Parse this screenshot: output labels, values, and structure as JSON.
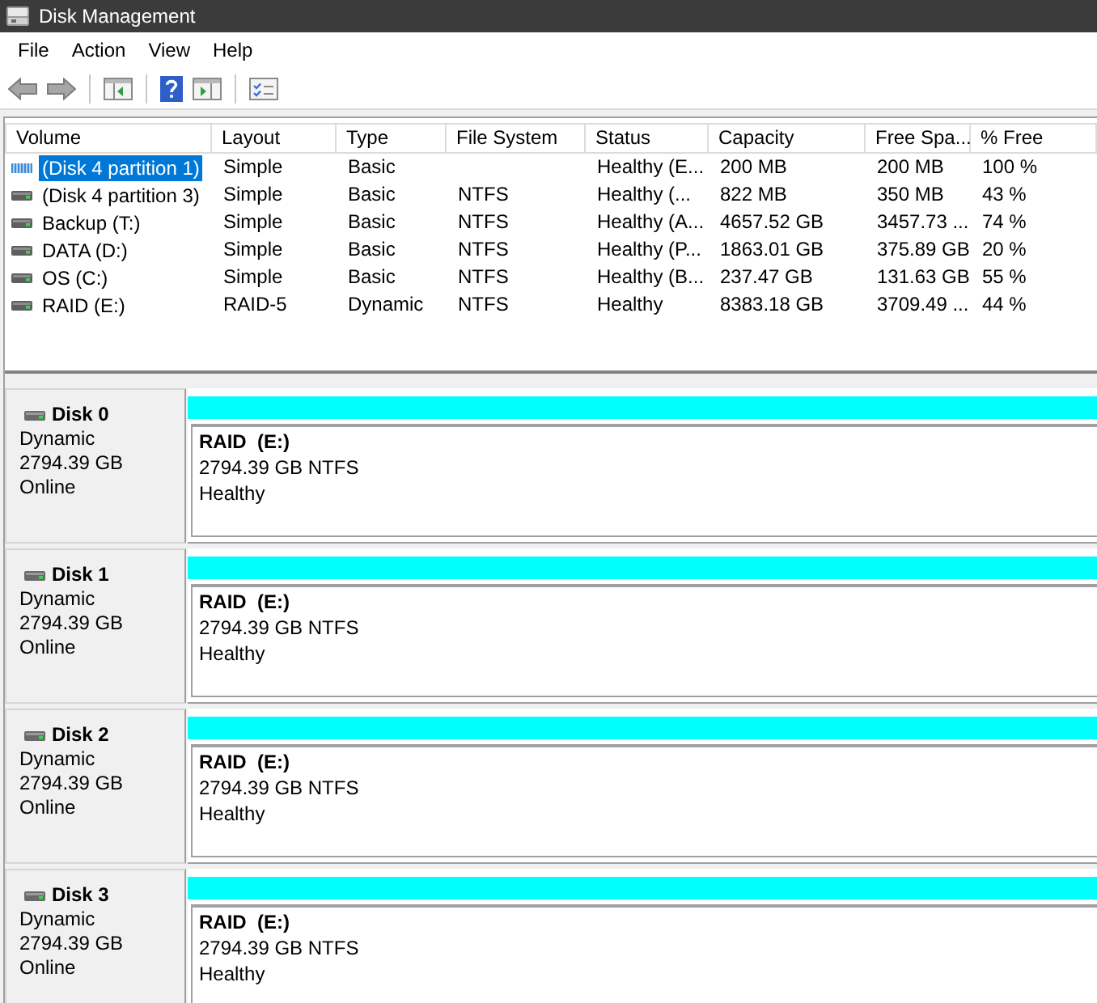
{
  "window": {
    "title": "Disk Management"
  },
  "menu": [
    "File",
    "Action",
    "View",
    "Help"
  ],
  "toolbar": [
    {
      "buttons": [
        {
          "kind": "back"
        },
        {
          "kind": "forward"
        }
      ]
    },
    {
      "buttons": [
        {
          "kind": "console-tree"
        }
      ]
    },
    {
      "buttons": [
        {
          "kind": "help"
        },
        {
          "kind": "action-pane"
        }
      ]
    },
    {
      "buttons": [
        {
          "kind": "properties"
        }
      ]
    }
  ],
  "volume_list": {
    "columns": [
      "Volume",
      "Layout",
      "Type",
      "File System",
      "Status",
      "Capacity",
      "Free Spa...",
      "% Free"
    ],
    "rows": [
      {
        "selected": true,
        "volume": "(Disk 4 partition 1)",
        "layout": "Simple",
        "type": "Basic",
        "status": "Healthy (E...",
        "capacity": "200 MB",
        "free_space": "200 MB",
        "percent_free": "100 %"
      },
      {
        "selected": false,
        "volume": "(Disk 4 partition 3)",
        "layout": "Simple",
        "type": "Basic",
        "file_system": "NTFS",
        "status": "Healthy (...",
        "capacity": "822 MB",
        "free_space": "350 MB",
        "percent_free": "43 %"
      },
      {
        "selected": false,
        "volume": "Backup (T:)",
        "layout": "Simple",
        "type": "Basic",
        "file_system": "NTFS",
        "status": "Healthy (A...",
        "capacity": "4657.52 GB",
        "free_space": "3457.73 ...",
        "percent_free": "74 %"
      },
      {
        "selected": false,
        "volume": "DATA (D:)",
        "layout": "Simple",
        "type": "Basic",
        "file_system": "NTFS",
        "status": "Healthy (P...",
        "capacity": "1863.01 GB",
        "free_space": "375.89 GB",
        "percent_free": "20 %"
      },
      {
        "selected": false,
        "volume": "OS (C:)",
        "layout": "Simple",
        "type": "Basic",
        "file_system": "NTFS",
        "status": "Healthy (B...",
        "capacity": "237.47 GB",
        "free_space": "131.63 GB",
        "percent_free": "55 %"
      },
      {
        "selected": false,
        "volume": "RAID (E:)",
        "layout": "RAID-5",
        "type": "Dynamic",
        "file_system": "NTFS",
        "status": "Healthy",
        "capacity": "8383.18 GB",
        "free_space": "3709.49 ...",
        "percent_free": "44 %"
      }
    ]
  },
  "disks": [
    {
      "name": "Disk 0",
      "type": "Dynamic",
      "size": "2794.39 GB",
      "status": "Online",
      "partitions": [
        {
          "name": "RAID  (E:)",
          "size": "2794.39 GB NTFS",
          "status": "Healthy",
          "color": "#00ffff"
        }
      ]
    },
    {
      "name": "Disk 1",
      "type": "Dynamic",
      "size": "2794.39 GB",
      "status": "Online",
      "partitions": [
        {
          "name": "RAID  (E:)",
          "size": "2794.39 GB NTFS",
          "status": "Healthy",
          "color": "#00ffff"
        }
      ]
    },
    {
      "name": "Disk 2",
      "type": "Dynamic",
      "size": "2794.39 GB",
      "status": "Online",
      "partitions": [
        {
          "name": "RAID  (E:)",
          "size": "2794.39 GB NTFS",
          "status": "Healthy",
          "color": "#00ffff"
        }
      ]
    },
    {
      "name": "Disk 3",
      "type": "Dynamic",
      "size": "2794.39 GB",
      "status": "Online",
      "partitions": [
        {
          "name": "RAID  (E:)",
          "size": "2794.39 GB NTFS",
          "status": "Healthy",
          "color": "#00ffff"
        }
      ]
    }
  ]
}
